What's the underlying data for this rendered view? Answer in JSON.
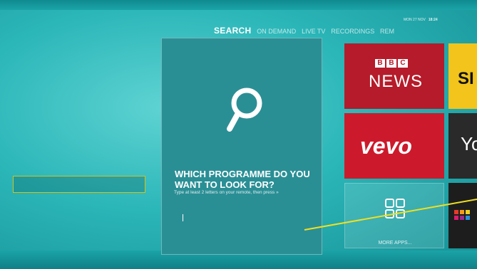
{
  "header": {
    "date": "MON 27 NOV",
    "time": "18:24"
  },
  "nav": {
    "tabs": [
      {
        "label": "SEARCH",
        "active": true
      },
      {
        "label": "ON DEMAND"
      },
      {
        "label": "LIVE TV"
      },
      {
        "label": "RECORDINGS"
      },
      {
        "label": "REM"
      }
    ]
  },
  "search": {
    "question": "WHICH PROGRAMME DO YOU WANT TO LOOK FOR?",
    "hint": "Type at least 2 letters on your remote, then press »",
    "input_value": "",
    "icon": "magnifier-icon"
  },
  "apps": {
    "bbc_letters": [
      "B",
      "B",
      "C"
    ],
    "bbc_label": "NEWS",
    "sky_label": "SI",
    "vevo_label": "vevo",
    "youtube_label": "Yo",
    "more_label": "MORE APPS..."
  },
  "colors": {
    "accent": "#d4c21a",
    "bbc": "#b51b2a",
    "vevo": "#cc1a2c",
    "sky": "#f2c41c",
    "pointer": "#f0e020"
  }
}
